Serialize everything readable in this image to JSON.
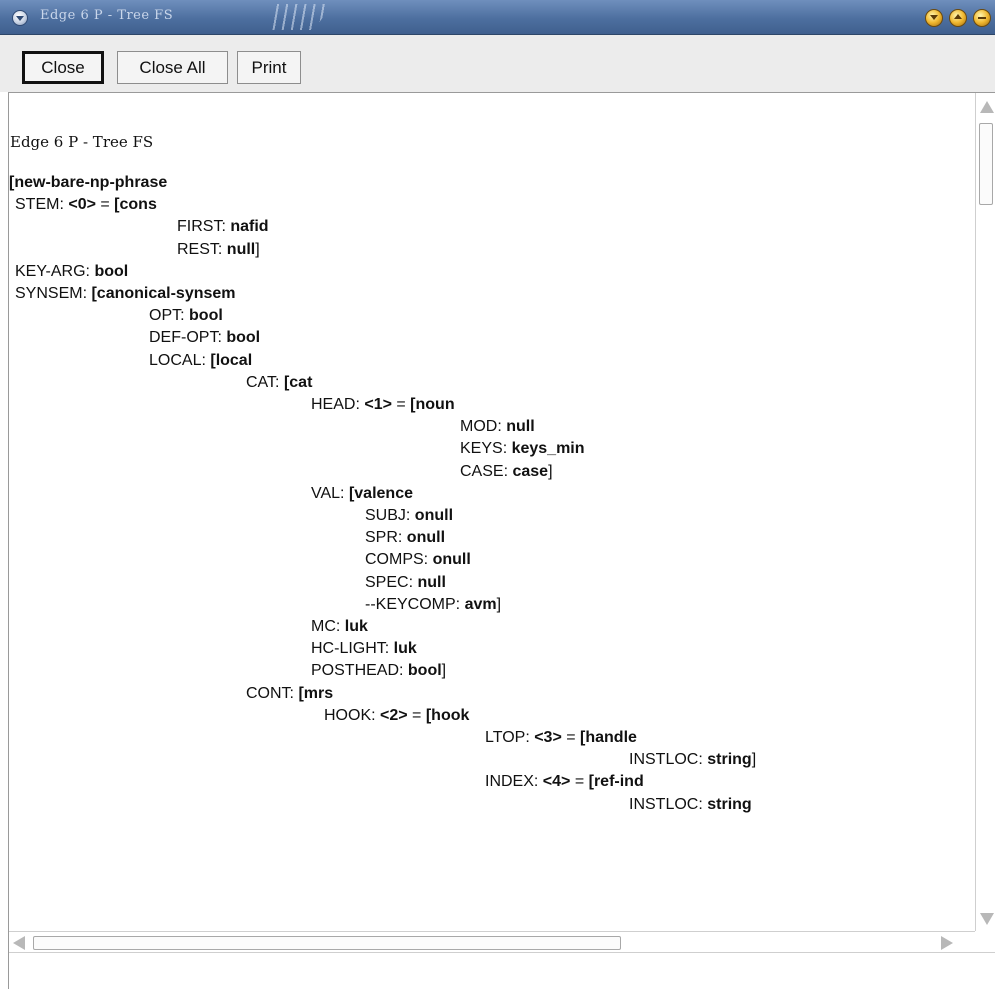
{
  "window": {
    "title": "Edge 6 P - Tree FS"
  },
  "toolbar": {
    "close_label": "Close",
    "close_all_label": "Close All",
    "print_label": "Print"
  },
  "document": {
    "title": "Edge 6 P - Tree FS",
    "lines": [
      {
        "pre": "",
        "bold": "[new-bare-np-phrase",
        "post": ""
      },
      {
        "pre": "STEM: ",
        "bold": "<0>",
        "post": " = ",
        "bold2": "[cons"
      },
      {
        "pre": "FIRST: ",
        "bold": "nafid",
        "post": ""
      },
      {
        "pre": "REST: ",
        "bold": "null",
        "post": "]"
      },
      {
        "pre": "KEY-ARG: ",
        "bold": "bool",
        "post": ""
      },
      {
        "pre": "SYNSEM: ",
        "bold": "[canonical-synsem",
        "post": ""
      },
      {
        "pre": "OPT: ",
        "bold": "bool",
        "post": ""
      },
      {
        "pre": "DEF-OPT: ",
        "bold": "bool",
        "post": ""
      },
      {
        "pre": "LOCAL: ",
        "bold": "[local",
        "post": ""
      },
      {
        "pre": "CAT: ",
        "bold": "[cat",
        "post": ""
      },
      {
        "pre": "HEAD: ",
        "bold": "<1>",
        "post": " = ",
        "bold2": "[noun"
      },
      {
        "pre": "MOD: ",
        "bold": "null",
        "post": ""
      },
      {
        "pre": "KEYS: ",
        "bold": "keys_min",
        "post": ""
      },
      {
        "pre": "CASE: ",
        "bold": "case",
        "post": "]"
      },
      {
        "pre": "VAL: ",
        "bold": "[valence",
        "post": ""
      },
      {
        "pre": "SUBJ: ",
        "bold": "onull",
        "post": ""
      },
      {
        "pre": "SPR: ",
        "bold": "onull",
        "post": ""
      },
      {
        "pre": "COMPS: ",
        "bold": "onull",
        "post": ""
      },
      {
        "pre": "SPEC: ",
        "bold": "null",
        "post": ""
      },
      {
        "pre": "--KEYCOMP: ",
        "bold": "avm",
        "post": "]"
      },
      {
        "pre": "MC: ",
        "bold": "luk",
        "post": ""
      },
      {
        "pre": "HC-LIGHT: ",
        "bold": "luk",
        "post": ""
      },
      {
        "pre": "POSTHEAD: ",
        "bold": "bool",
        "post": "]"
      },
      {
        "pre": "CONT: ",
        "bold": "[mrs",
        "post": ""
      },
      {
        "pre": "HOOK: ",
        "bold": "<2>",
        "post": " = ",
        "bold2": "[hook"
      },
      {
        "pre": "LTOP: ",
        "bold": "<3>",
        "post": " = ",
        "bold2": "[handle"
      },
      {
        "pre": "INSTLOC: ",
        "bold": "string",
        "post": "]"
      },
      {
        "pre": "INDEX: ",
        "bold": "<4>",
        "post": " = ",
        "bold2": "[ref-ind"
      },
      {
        "pre": "INSTLOC: ",
        "bold": "string",
        "post": ""
      }
    ]
  },
  "colors": {
    "titlebar": "#4d6f9f",
    "toolbar_bg": "#ececec",
    "text": "#111111"
  }
}
